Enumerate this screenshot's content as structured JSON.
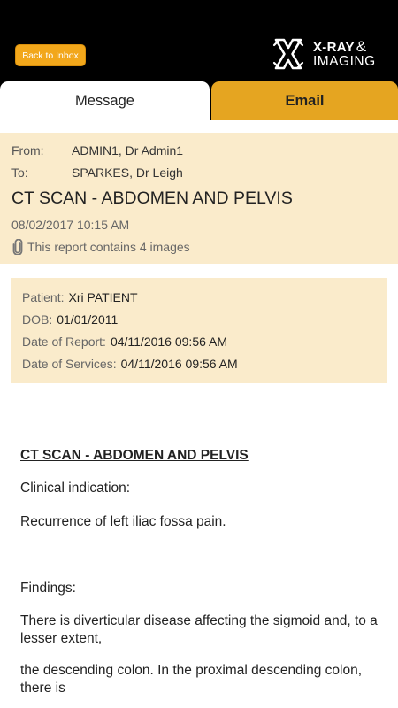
{
  "header": {
    "back_label": "Back to Inbox",
    "logo_line1": "X-RAY",
    "logo_amp": "&",
    "logo_line2": "IMAGING",
    "bg_color": "#000000",
    "accent": "#F2A71B"
  },
  "tabs": [
    {
      "label": "Message",
      "active": true
    },
    {
      "label": "Email",
      "active": false
    }
  ],
  "message": {
    "from_label": "From:",
    "from_value": "ADMIN1, Dr Admin1",
    "to_label": "To:",
    "to_value": "SPARKES, Dr Leigh",
    "subject": "CT SCAN - ABDOMEN AND PELVIS",
    "date": "08/02/2017 10:15 AM",
    "attachment_icon": "paperclip-icon",
    "attachment_text": "This report contains 4 images"
  },
  "patient": {
    "patient_label": "Patient:",
    "patient_value": "Xri PATIENT",
    "dob_label": "DOB:",
    "dob_value": "01/01/2011",
    "report_label": "Date of Report:",
    "report_value": "04/11/2016 09:56 AM",
    "services_label": "Date of Services:",
    "services_value": "04/11/2016 09:56 AM"
  },
  "report": {
    "title": "CT SCAN - ABDOMEN AND PELVIS",
    "clinical_heading": "Clinical indication:",
    "clinical_text": "Recurrence of left iliac fossa pain.",
    "findings_heading": "Findings:",
    "para1": "There is diverticular disease affecting the sigmoid and, to a lesser extent,",
    "para2": "the descending colon. In the proximal descending colon, there is"
  },
  "colors": {
    "panel_bg": "#FAEBCB",
    "email_tab": "#E5A521"
  }
}
